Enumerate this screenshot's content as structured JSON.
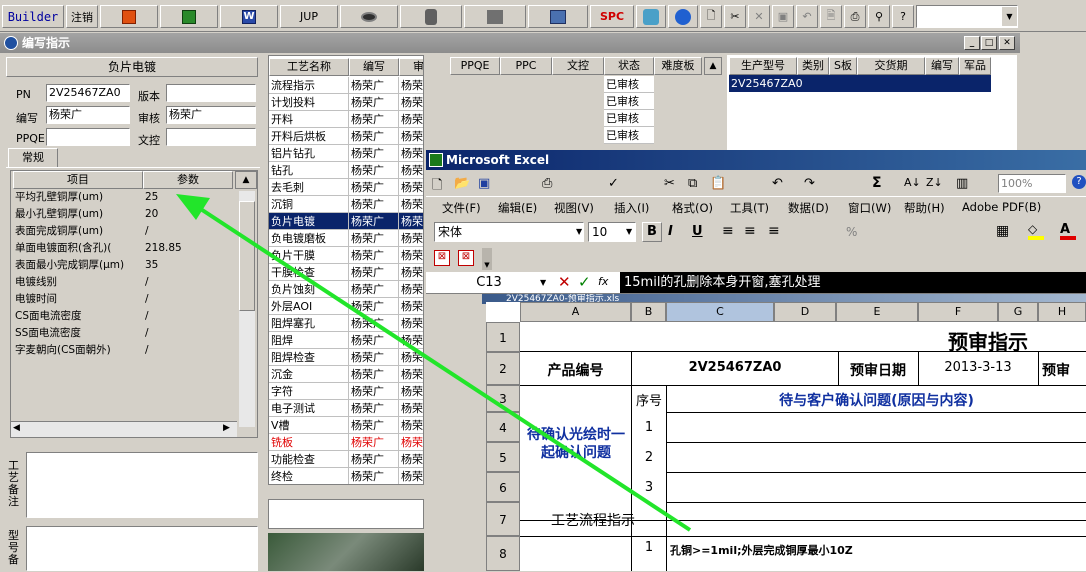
{
  "toolbar": {
    "builder": "Builder",
    "logout": "注销",
    "jup": "JUP",
    "spc": "SPC"
  },
  "left_window": {
    "title": "编写指示"
  },
  "form": {
    "heading": "负片电镀",
    "pn_label": "PN",
    "pn_value": "2V25467ZA0",
    "version_label": "版本",
    "version_value": "",
    "author_label": "编写",
    "author_value": "杨荣广",
    "review_label": "审核",
    "review_value": "杨荣广",
    "ppqe_label": "PPQE",
    "ppqe_value": "",
    "approve_label": "文控",
    "approve_value": "",
    "tab": "常规",
    "grid_headers": [
      "项目",
      "参数"
    ],
    "params": [
      {
        "name": "平均孔壁铜厚(um)",
        "value": "25"
      },
      {
        "name": "最小孔壁铜厚(um)",
        "value": "20"
      },
      {
        "name": "表面完成铜厚(um)",
        "value": "/"
      },
      {
        "name": "单面电镀面积(含孔)(",
        "value": "218.85"
      },
      {
        "name": "表面最小完成铜厚(μm)",
        "value": "35"
      },
      {
        "name": "电镀线别",
        "value": "/"
      },
      {
        "name": "电镀时间",
        "value": "/"
      },
      {
        "name": "CS面电流密度",
        "value": "/"
      },
      {
        "name": "SS面电流密度",
        "value": "/"
      },
      {
        "name": "字麦朝向(CS面朝外)",
        "value": "/"
      }
    ],
    "side_label_1": "工艺备注",
    "side_label_2": "型号备"
  },
  "process_table": {
    "headers": [
      "工艺名称",
      "编写",
      "审核",
      "PPQE",
      "PPC",
      "文控",
      "状态",
      "难度板"
    ],
    "rows": [
      {
        "name": "流程指示",
        "author": "杨荣广",
        "review": "杨荣广",
        "status": "已审核"
      },
      {
        "name": "计划投料",
        "author": "杨荣广",
        "review": "杨荣广",
        "status": "已审核"
      },
      {
        "name": "开料",
        "author": "杨荣广",
        "review": "杨荣广",
        "status": "已审核"
      },
      {
        "name": "开料后烘板",
        "author": "杨荣广",
        "review": "杨荣广",
        "status": "已审核"
      },
      {
        "name": "铝片钻孔",
        "author": "杨荣广",
        "review": "杨荣"
      },
      {
        "name": "钻孔",
        "author": "杨荣广",
        "review": "杨荣"
      },
      {
        "name": "去毛刺",
        "author": "杨荣广",
        "review": "杨荣"
      },
      {
        "name": "沉铜",
        "author": "杨荣广",
        "review": "杨荣"
      },
      {
        "name": "负片电镀",
        "author": "杨荣广",
        "review": "杨荣"
      },
      {
        "name": "负电镀磨板",
        "author": "杨荣广",
        "review": "杨荣"
      },
      {
        "name": "负片干膜",
        "author": "杨荣广",
        "review": "杨荣"
      },
      {
        "name": "干膜检查",
        "author": "杨荣广",
        "review": "杨荣"
      },
      {
        "name": "负片蚀刻",
        "author": "杨荣广",
        "review": "杨荣"
      },
      {
        "name": "外层AOI",
        "author": "杨荣广",
        "review": "杨荣"
      },
      {
        "name": "阻焊塞孔",
        "author": "杨荣广",
        "review": "杨荣"
      },
      {
        "name": "阻焊",
        "author": "杨荣广",
        "review": "杨荣"
      },
      {
        "name": "阻焊检查",
        "author": "杨荣广",
        "review": "杨荣"
      },
      {
        "name": "沉金",
        "author": "杨荣广",
        "review": "杨荣"
      },
      {
        "name": "字符",
        "author": "杨荣广",
        "review": "杨荣"
      },
      {
        "name": "电子测试",
        "author": "杨荣广",
        "review": "杨荣"
      },
      {
        "name": "V槽",
        "author": "杨荣广",
        "review": "杨荣"
      },
      {
        "name": "铣板",
        "author": "杨荣广",
        "review": "杨荣广"
      },
      {
        "name": "功能检查",
        "author": "杨荣广",
        "review": "杨荣"
      },
      {
        "name": "终检",
        "author": "杨荣广",
        "review": "杨荣"
      }
    ]
  },
  "right_table": {
    "headers": [
      "生产型号",
      "类别",
      "S板",
      "交货期",
      "编写",
      "军品"
    ],
    "row": "2V25467ZA0"
  },
  "excel": {
    "title": "Microsoft Excel",
    "menu": [
      "文件(F)",
      "编辑(E)",
      "视图(V)",
      "插入(I)",
      "格式(O)",
      "工具(T)",
      "数据(D)",
      "窗口(W)",
      "帮助(H)",
      "Adobe PDF(B)"
    ],
    "font": "宋体",
    "size": "10",
    "zoom": "100%",
    "cell_ref": "C13",
    "fx": "fx",
    "formula": "15mil的孔删除本身开窗,塞孔处理",
    "workbook_title": "2V25467ZA0-预审指示.xls",
    "columns": [
      "A",
      "B",
      "C",
      "D",
      "E",
      "F",
      "G",
      "H"
    ],
    "rows": [
      "1",
      "2",
      "3",
      "4",
      "5",
      "6",
      "7",
      "8"
    ],
    "sheet_title": "预审指示",
    "product_label": "产品编号",
    "product_value": "2V25467ZA0",
    "date_label": "预审日期",
    "date_value": "2013-3-13",
    "trail_label": "预审",
    "seq_label": "序号",
    "confirm_header": "待与客户确认问题(原因与内容)",
    "left_note": "待确认光绘时一起确认问题",
    "seq": [
      "1",
      "2",
      "3"
    ],
    "flow_label": "工艺流程指示",
    "flow_seq": "1",
    "flow_text": "孔铜>=1mil;外层完成铜厚最小10Z"
  },
  "colors": {
    "arrow": "#22e52a",
    "selection": "#0a246a",
    "excel_title": "#0a246a"
  }
}
